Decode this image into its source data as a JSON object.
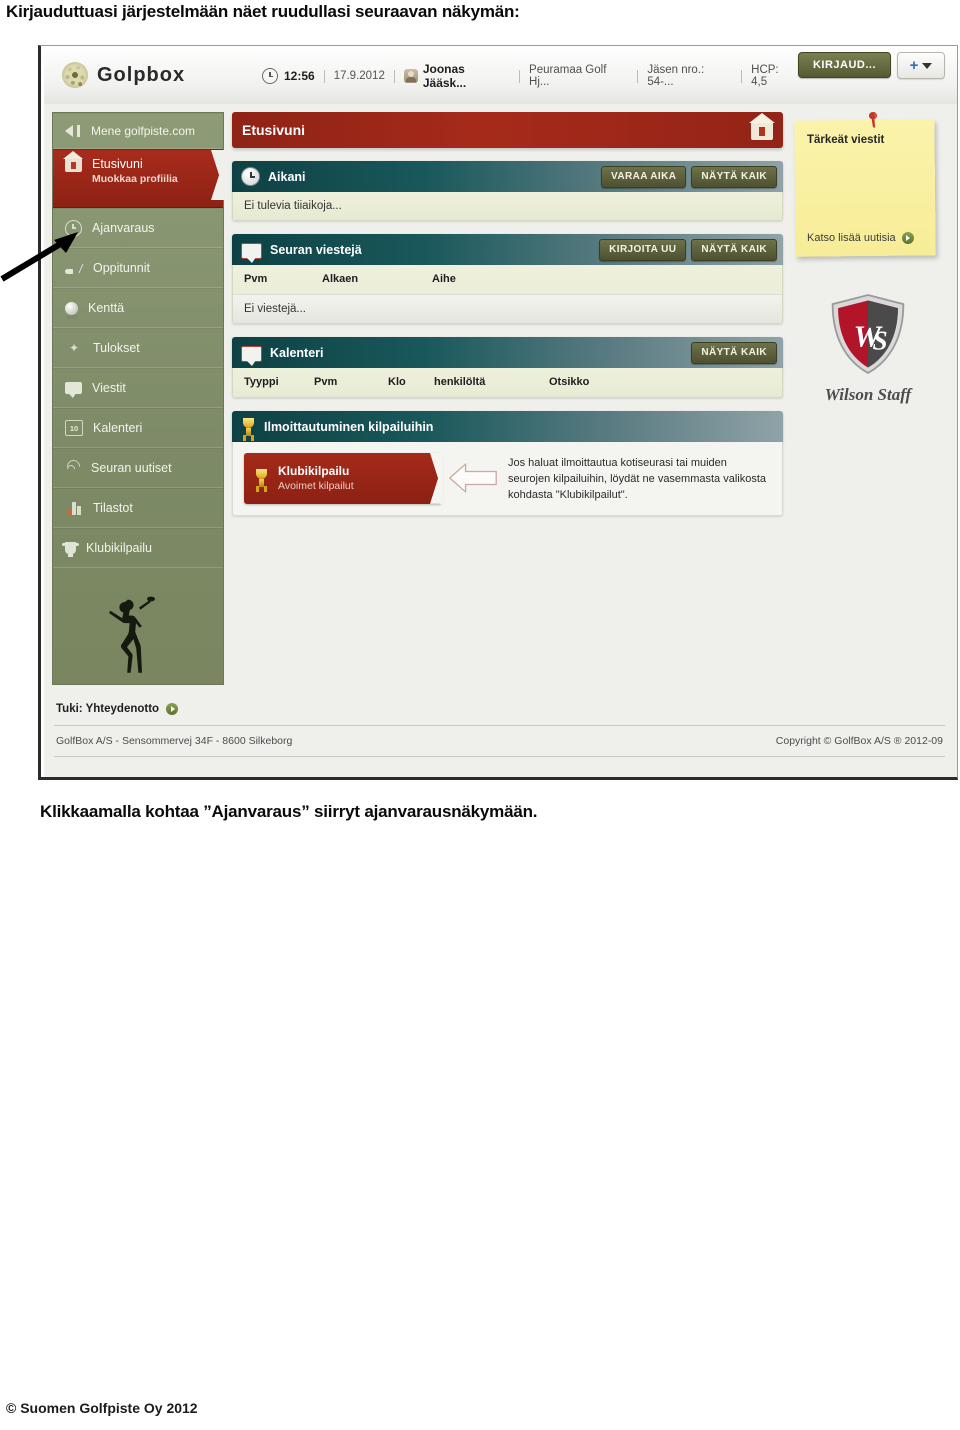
{
  "document": {
    "intro": "Kirjauduttuasi järjestelmään näet ruudullasi seuraavan näkymän:",
    "caption": "Klikkaamalla kohtaa ”Ajanvaraus” siirryt ajanvarausnäkymään.",
    "footer": "© Suomen Golfpiste Oy 2012"
  },
  "topbar": {
    "logo_text": "Golpbox",
    "logo_icon": "globe-icon",
    "clock_icon": "clock-icon",
    "time": "12:56",
    "date": "17.9.2012",
    "person_icon": "person-icon",
    "user_name": "Joonas Jääsk...",
    "club": "Peuramaa Golf Hj...",
    "member_no": "Jäsen nro.: 54-...",
    "hcp": "HCP: 4,5",
    "login_button": "KIRJAUD...",
    "add_button_icon": "plus-dropdown-icon"
  },
  "sidebar": {
    "items": [
      {
        "label": "Mene golfpiste.com",
        "icon": "arrow-bar-icon",
        "sub": "",
        "active": false
      },
      {
        "label": "Etusivuni",
        "icon": "home-icon",
        "sub": "Muokkaa profiilia",
        "active": true
      },
      {
        "label": "Ajanvaraus",
        "icon": "clock-icon",
        "sub": "",
        "active": false
      },
      {
        "label": "Oppitunnit",
        "icon": "golf-club-icon",
        "sub": "",
        "active": false
      },
      {
        "label": "Kenttä",
        "icon": "golf-ball-icon",
        "sub": "",
        "active": false
      },
      {
        "label": "Tulokset",
        "icon": "results-icon",
        "sub": "",
        "active": false
      },
      {
        "label": "Viestit",
        "icon": "message-icon",
        "sub": "",
        "active": false
      },
      {
        "label": "Kalenteri",
        "icon": "calendar-icon",
        "sub": "",
        "active": false
      },
      {
        "label": "Seuran uutiset",
        "icon": "rss-icon",
        "sub": "",
        "active": false
      },
      {
        "label": "Tilastot",
        "icon": "bar-chart-icon",
        "sub": "",
        "active": false
      },
      {
        "label": "Klubikilpailu",
        "icon": "trophy-icon",
        "sub": "",
        "active": false
      }
    ],
    "golfer_icon": "golfer-silhouette-icon"
  },
  "page": {
    "title": "Etusivuni",
    "home_icon": "home-icon"
  },
  "panels": {
    "aikani": {
      "title": "Aikani",
      "icon": "clock-icon",
      "buttons": [
        "VARAA AIKA",
        "NÄYTÄ KAIK"
      ],
      "empty_text": "Ei tulevia tiiaikoja..."
    },
    "viestit": {
      "title": "Seuran viestejä",
      "icon": "message-icon",
      "buttons": [
        "KIRJOITA UU",
        "NÄYTÄ KAIK"
      ],
      "columns": [
        "Pvm",
        "Alkaen",
        "Aihe"
      ],
      "empty_text": "Ei viestejä..."
    },
    "kalenteri": {
      "title": "Kalenteri",
      "icon": "message-icon",
      "buttons": [
        "NÄYTÄ KAIK"
      ],
      "columns": [
        "Tyyppi",
        "Pvm",
        "Klo",
        "henkilöltä",
        "Otsikko"
      ]
    },
    "kilpailut": {
      "title": "Ilmoittautuminen kilpailuihin",
      "icon": "trophy-icon",
      "tile_title": "Klubikilpailu",
      "tile_subtitle": "Avoimet kilpailut",
      "tile_icon": "trophy-icon",
      "arrow_icon": "left-arrow-icon",
      "hint": "Jos haluat ilmoittautua kotiseurasi tai muiden seurojen kilpailuihin, löydät ne vasemmasta valikosta kohdasta \"Klubikilpailut\"."
    }
  },
  "right_column": {
    "note_title": "Tärkeät viestit",
    "note_link": "Katso lisää uutisia",
    "note_link_icon": "play-circle-icon",
    "pin_icon": "pushpin-icon",
    "sponsor_name": "Wilson Staff",
    "sponsor_icon": "wilson-staff-shield-icon"
  },
  "app_footer": {
    "support": "Tuki: Yhteydenotto",
    "support_icon": "play-circle-icon",
    "address": "GolfBox A/S - Sensommervej 34F - 8600 Silkeborg",
    "copyright": "Copyright © GolfBox A/S ® 2012-09"
  },
  "annotation": {
    "arrow_icon": "pointer-arrow-icon"
  },
  "colors": {
    "accent_red": "#a52a19",
    "sidebar_green": "#7d8a67",
    "panel_teal": "#0e4144",
    "button_olive": "#5b5f38",
    "note_yellow": "#fbf3ab"
  }
}
